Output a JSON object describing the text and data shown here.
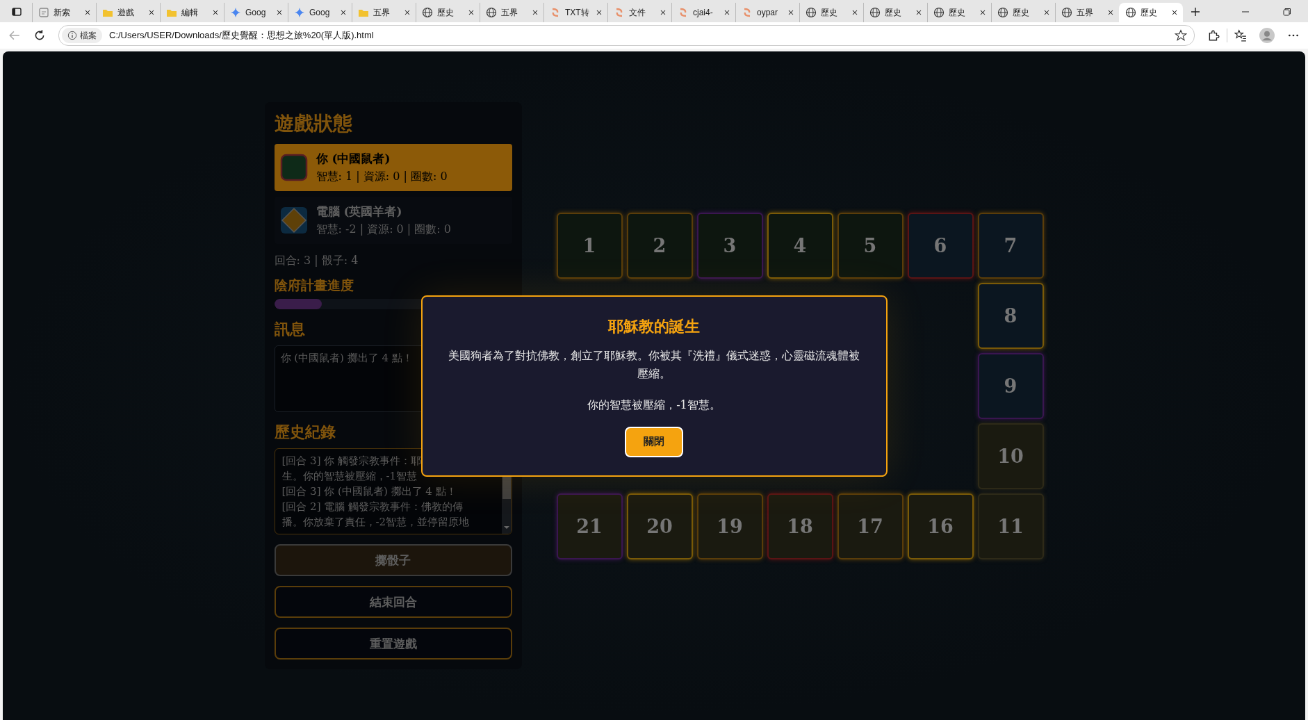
{
  "browser": {
    "tabs": [
      {
        "title": "新索",
        "kind": "page",
        "selected": false
      },
      {
        "title": "遊戲",
        "kind": "folder",
        "selected": false
      },
      {
        "title": "編輯",
        "kind": "folder",
        "selected": false
      },
      {
        "title": "Goog",
        "kind": "sparkle",
        "selected": false
      },
      {
        "title": "Goog",
        "kind": "sparkle",
        "selected": false
      },
      {
        "title": "五界",
        "kind": "folder",
        "selected": false
      },
      {
        "title": "歷史",
        "kind": "globe",
        "selected": false
      },
      {
        "title": "五界",
        "kind": "globe",
        "selected": false
      },
      {
        "title": "TXT转",
        "kind": "swirl",
        "selected": false
      },
      {
        "title": "文件",
        "kind": "swirl",
        "selected": false
      },
      {
        "title": "cjai4-",
        "kind": "swirl",
        "selected": false
      },
      {
        "title": "oypar",
        "kind": "swirl",
        "selected": false
      },
      {
        "title": "歷史",
        "kind": "globe",
        "selected": false
      },
      {
        "title": "歷史",
        "kind": "globe",
        "selected": false
      },
      {
        "title": "歷史",
        "kind": "globe",
        "selected": false
      },
      {
        "title": "歷史",
        "kind": "globe",
        "selected": false
      },
      {
        "title": "五界",
        "kind": "globe",
        "selected": false
      },
      {
        "title": "歷史",
        "kind": "globe",
        "selected": true
      }
    ],
    "address": {
      "chip": "檔案",
      "url": "C:/Users/USER/Downloads/歷史覺醒：思想之旅%20(單人版).html"
    }
  },
  "status_panel": {
    "title": "遊戲狀態",
    "players": [
      {
        "name": "你 (中國鼠者)",
        "stats": "智慧: 1 | 資源: 0 | 圈數: 0",
        "kind": "square",
        "selected": true
      },
      {
        "name": "電腦 (英國羊者)",
        "stats": "智慧: -2 | 資源: 0 | 圈數: 0",
        "kind": "diamond",
        "selected": false
      }
    ],
    "turn_info": "回合: 3 | 骰子: 4",
    "progress": {
      "title": "陰府計畫進度",
      "level": 0.2
    },
    "messages": {
      "title": "訊息",
      "text": "你 (中國鼠者) 擲出了 4 點！"
    },
    "history": {
      "title": "歷史紀錄",
      "lines": [
        "[回合 3] 你 觸發宗教事件：耶",
        "生。你的智慧被壓縮，-1智慧",
        "[回合 3] 你 (中國鼠者) 擲出了 4 點！",
        "[回合 2] 電腦 觸發宗教事件：佛教的傳",
        "播。你放棄了責任，-2智慧，並停留原地"
      ]
    },
    "buttons": [
      {
        "label": "擲骰子",
        "disabled": true
      },
      {
        "label": "結束回合",
        "disabled": false
      },
      {
        "label": "重置遊戲",
        "disabled": false
      }
    ]
  },
  "board": {
    "rows": [
      [
        {
          "kind": "land",
          "number": "1",
          "color": "#5a3d0a"
        },
        {
          "kind": "land",
          "number": "2",
          "color": "#5a3d0a"
        },
        {
          "kind": "land",
          "number": "3",
          "color": "#3a1650"
        },
        {
          "kind": "land",
          "number": "4",
          "color": "#7a5a08"
        },
        {
          "kind": "land",
          "number": "5",
          "color": "#5a3d0a"
        },
        {
          "kind": "water",
          "number": "6",
          "color": "#5a1414"
        },
        {
          "kind": "water",
          "number": "7",
          "color": "#5a3d0a"
        }
      ],
      [
        {
          "kind": "empty"
        },
        {
          "kind": "empty"
        },
        {
          "kind": "empty"
        },
        {
          "kind": "empty"
        },
        {
          "kind": "empty"
        },
        {
          "kind": "empty"
        },
        {
          "kind": "water",
          "number": "8",
          "color": "#7a5a08"
        }
      ],
      [
        {
          "kind": "empty"
        },
        {
          "kind": "empty"
        },
        {
          "kind": "empty"
        },
        {
          "kind": "empty"
        },
        {
          "kind": "empty"
        },
        {
          "kind": "empty"
        },
        {
          "kind": "water",
          "number": "9",
          "color": "#3a1650"
        }
      ],
      [
        {
          "kind": "empty"
        },
        {
          "kind": "empty"
        },
        {
          "kind": "empty"
        },
        {
          "kind": "empty"
        },
        {
          "kind": "empty"
        },
        {
          "kind": "empty"
        },
        {
          "kind": "sand",
          "number": "10",
          "color": "#2e2a18"
        }
      ],
      [
        {
          "kind": "sand",
          "number": "21",
          "color": "#3a1650"
        },
        {
          "kind": "sand",
          "number": "20",
          "color": "#7a5a08"
        },
        {
          "kind": "sand",
          "number": "19",
          "color": "#5a3d0a"
        },
        {
          "kind": "sand",
          "number": "18",
          "color": "#5a1414"
        },
        {
          "kind": "sand",
          "number": "17",
          "color": "#5a3d0a"
        },
        {
          "kind": "sand",
          "number": "16",
          "color": "#7a5a08"
        },
        {
          "kind": "sand",
          "number": "11",
          "color": "#2e2a18"
        }
      ]
    ]
  },
  "modal": {
    "title": "耶穌教的誕生",
    "body": "美國狗者為了對抗佛教，創立了耶穌教。你被其『洗禮』儀式迷惑，心靈磁流魂體被壓縮。",
    "effect": "你的智慧被壓縮，-1智慧。",
    "button": "關閉"
  }
}
